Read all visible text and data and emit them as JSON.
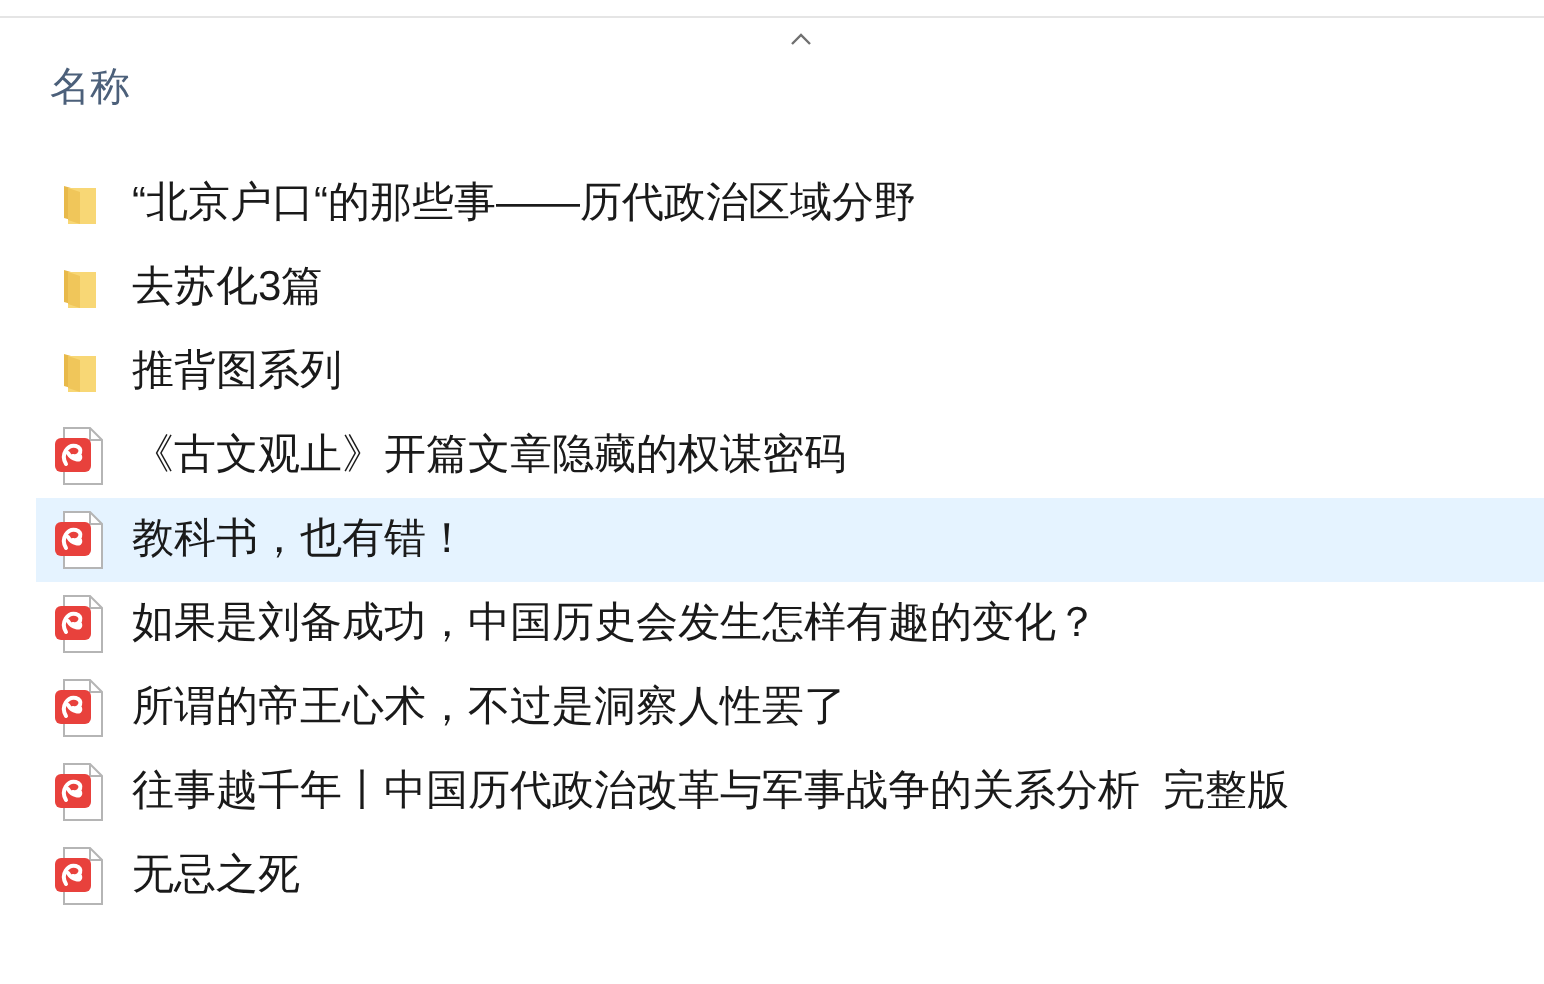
{
  "header": {
    "column_label": "名称"
  },
  "items": [
    {
      "kind": "folder",
      "name": "“北京户口“的那些事——历代政治区域分野",
      "selected": false
    },
    {
      "kind": "folder",
      "name": "去苏化3篇",
      "selected": false
    },
    {
      "kind": "folder",
      "name": "推背图系列",
      "selected": false
    },
    {
      "kind": "document",
      "name": "《古文观止》开篇文章隐藏的权谋密码",
      "selected": false
    },
    {
      "kind": "document",
      "name": "教科书，也有错！",
      "selected": true
    },
    {
      "kind": "document",
      "name": "如果是刘备成功，中国历史会发生怎样有趣的变化？",
      "selected": false
    },
    {
      "kind": "document",
      "name": "所谓的帝王心术，不过是洞察人性罢了",
      "selected": false
    },
    {
      "kind": "document",
      "name": "往事越千年丨中国历代政治改革与军事战争的关系分析  完整版",
      "selected": false
    },
    {
      "kind": "document",
      "name": "无忌之死",
      "selected": false
    }
  ]
}
